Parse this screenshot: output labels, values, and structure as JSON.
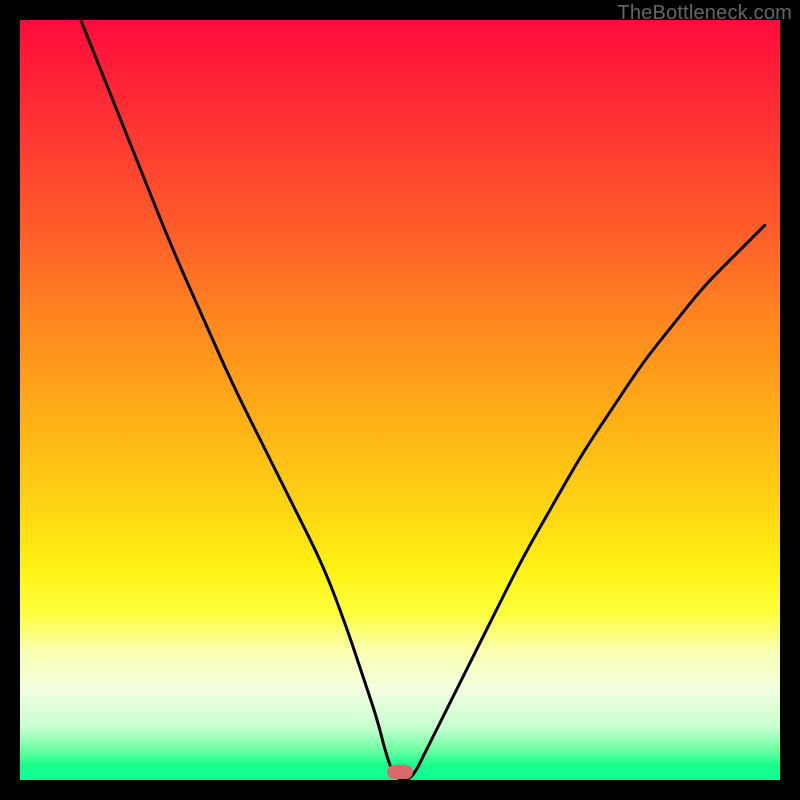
{
  "watermark": "TheBottleneck.com",
  "marker": {
    "x_pct": 50.0,
    "y_pct": 99.0
  },
  "chart_data": {
    "type": "line",
    "title": "",
    "xlabel": "",
    "ylabel": "",
    "xlim": [
      0,
      100
    ],
    "ylim": [
      0,
      100
    ],
    "series": [
      {
        "name": "bottleneck-curve",
        "x": [
          8,
          12,
          16,
          20,
          24,
          28,
          32,
          36,
          40,
          43,
          45,
          47,
          48,
          49,
          50,
          51,
          52,
          53,
          55,
          58,
          62,
          66,
          70,
          74,
          78,
          82,
          86,
          90,
          94,
          98
        ],
        "y": [
          100,
          90,
          80,
          70,
          61,
          52,
          44,
          36,
          28,
          20,
          14,
          8,
          4,
          1,
          0,
          0,
          1,
          3,
          7,
          13,
          21,
          29,
          36,
          43,
          49,
          55,
          60,
          65,
          69,
          73
        ]
      }
    ],
    "marker": {
      "x": 50,
      "y": 0
    },
    "background_gradient": {
      "top": "#ff0b3c",
      "mid": "#fff213",
      "bottom": "#0bff96"
    }
  }
}
